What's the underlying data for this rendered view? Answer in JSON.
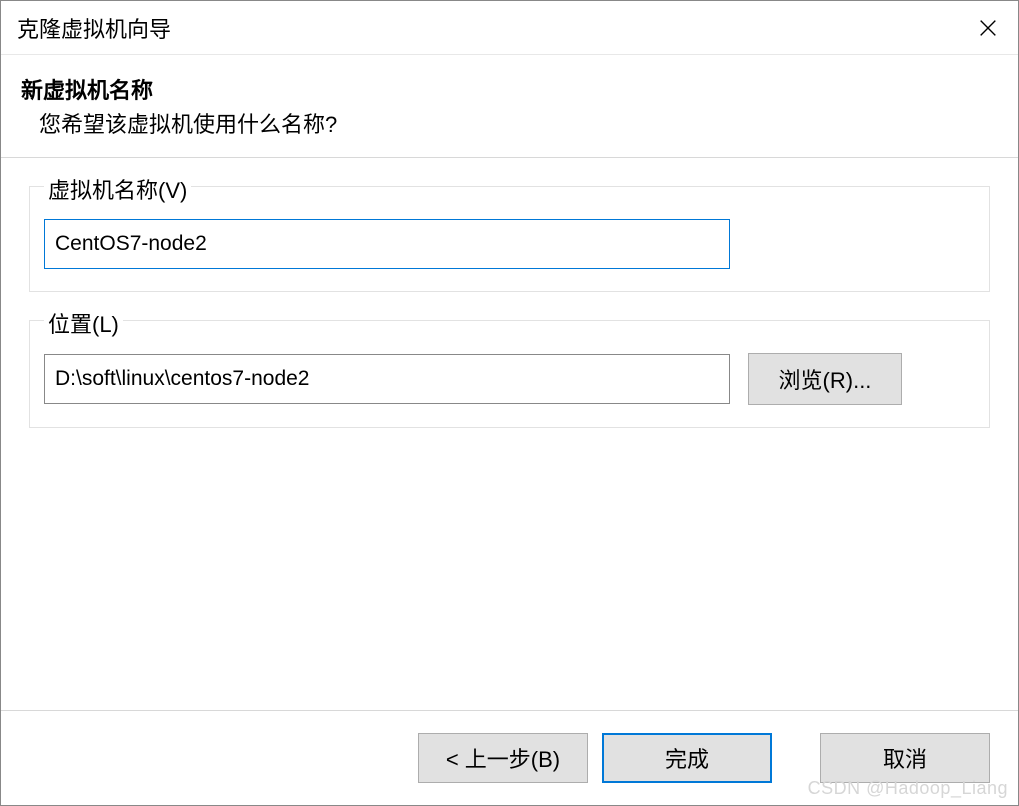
{
  "titlebar": {
    "title": "克隆虚拟机向导"
  },
  "header": {
    "title": "新虚拟机名称",
    "subtitle": "您希望该虚拟机使用什么名称?"
  },
  "vm_name": {
    "legend": "虚拟机名称(V)",
    "value": "CentOS7-node2"
  },
  "location": {
    "legend": "位置(L)",
    "value": "D:\\soft\\linux\\centos7-node2",
    "browse_label": "浏览(R)..."
  },
  "footer": {
    "back_label": "< 上一步(B)",
    "finish_label": "完成",
    "cancel_label": "取消"
  },
  "watermark": "CSDN @Hadoop_Liang"
}
